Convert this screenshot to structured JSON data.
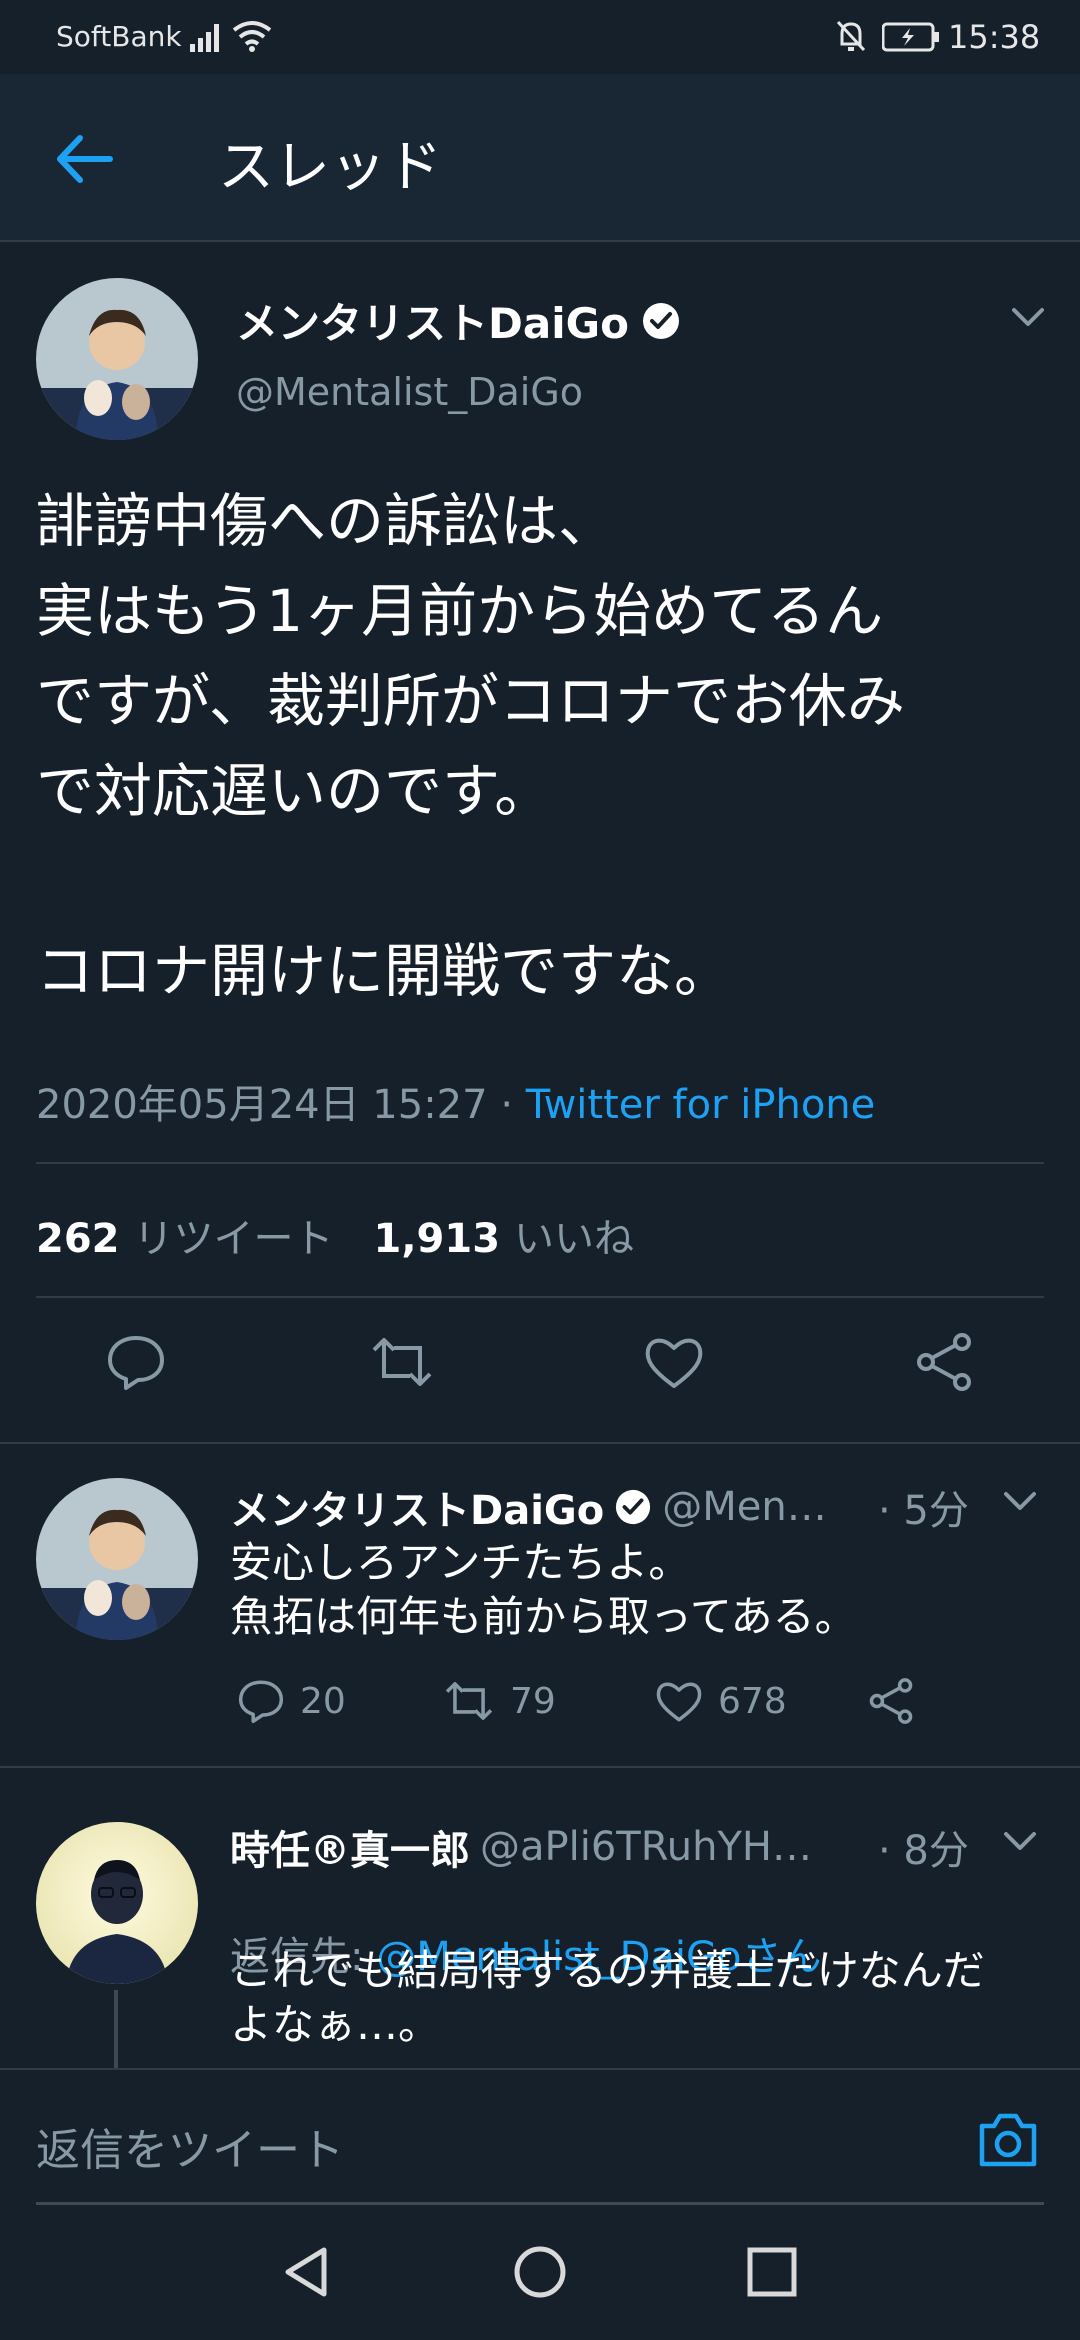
{
  "status_bar": {
    "carrier": "SoftBank",
    "time": "15:38"
  },
  "header": {
    "title": "スレッド"
  },
  "main_tweet": {
    "author_name": "メンタリストDaiGo",
    "handle": "@Mentalist_DaiGo",
    "text": "誹謗中傷への訴訟は、\n実はもう1ヶ月前から始めてるん\nですが、裁判所がコロナでお休み\nで対応遅いのです。\n\nコロナ開けに開戦ですな。",
    "timestamp": "2020年05月24日 15:27",
    "separator": "·",
    "source": "Twitter for iPhone",
    "retweets": "262",
    "retweets_label": "リツイート",
    "likes": "1,913",
    "likes_label": "いいね"
  },
  "replies": [
    {
      "author_name": "メンタリストDaiGo",
      "handle": "@Men…",
      "time": "· 5分",
      "text": "安心しろアンチたちよ。\n魚拓は何年も前から取ってある。",
      "reply_count": "20",
      "retweet_count": "79",
      "like_count": "678"
    },
    {
      "author_name": "時任®真一郎",
      "handle": "@aPli6TRuhYH…",
      "time": "· 8分",
      "reply_to_prefix": "返信先: ",
      "reply_to": "@Mentalist_DaiGoさん",
      "text": "これでも結局得するの弁護士だけなんだ\nよなぁ…。"
    }
  ],
  "compose": {
    "placeholder": "返信をツイート"
  },
  "colors": {
    "background": "#15202b",
    "header": "#192734",
    "accent": "#1da1f2",
    "muted": "#8899a6"
  },
  "icons": [
    "back-arrow-icon",
    "verified-badge-icon",
    "chevron-down-icon",
    "reply-icon",
    "retweet-icon",
    "like-icon",
    "share-icon",
    "camera-icon"
  ]
}
